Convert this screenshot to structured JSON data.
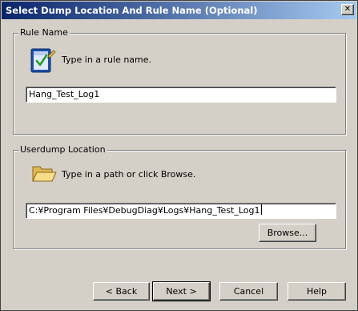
{
  "window": {
    "title": "Select Dump Location And Rule Name (Optional)",
    "close_glyph": "✕"
  },
  "rule_name": {
    "legend": "Rule Name",
    "icon": "notepad-check-icon",
    "hint": "Type in a rule name.",
    "value": "Hang_Test_Log1"
  },
  "userdump": {
    "legend": "Userdump Location",
    "icon": "folder-open-icon",
    "hint": "Type in a path or click Browse.",
    "value": "C:¥Program Files¥DebugDiag¥Logs¥Hang_Test_Log1",
    "browse_label": "Browse..."
  },
  "footer": {
    "back_label": "< Back",
    "next_label": "Next >",
    "cancel_label": "Cancel",
    "help_label": "Help"
  },
  "colors": {
    "dialog_bg": "#d4d0c8",
    "title_start": "#0a246a",
    "title_end": "#a6caf0",
    "field_bg": "#ffffff"
  }
}
